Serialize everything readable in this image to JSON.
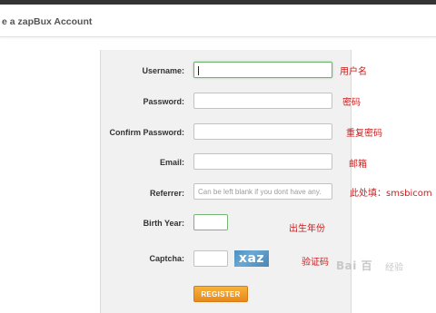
{
  "header": {
    "title": "e a zapBux Account"
  },
  "form": {
    "username": {
      "label": "Username:",
      "value": ""
    },
    "password": {
      "label": "Password:"
    },
    "confirm_password": {
      "label": "Confirm Password:"
    },
    "email": {
      "label": "Email:"
    },
    "referrer": {
      "label": "Referrer:",
      "placeholder": "Can be left blank if you dont have any."
    },
    "birth_year": {
      "label": "Birth Year:"
    },
    "captcha": {
      "label": "Captcha:",
      "image_text": "xaz"
    },
    "register_button": "REGISTER"
  },
  "annotations": {
    "username": "用户名",
    "password": "密码",
    "confirm_password": "重复密码",
    "email": "邮箱",
    "referrer": "此处填：smsbicom",
    "birth_year": "出生年份",
    "captcha": "验证码"
  },
  "watermark": {
    "logo": "Bai 百",
    "text": "经验"
  },
  "colors": {
    "annotation": "#c81e1e",
    "button": "#f0a02a",
    "focus_border": "#6db36d"
  }
}
